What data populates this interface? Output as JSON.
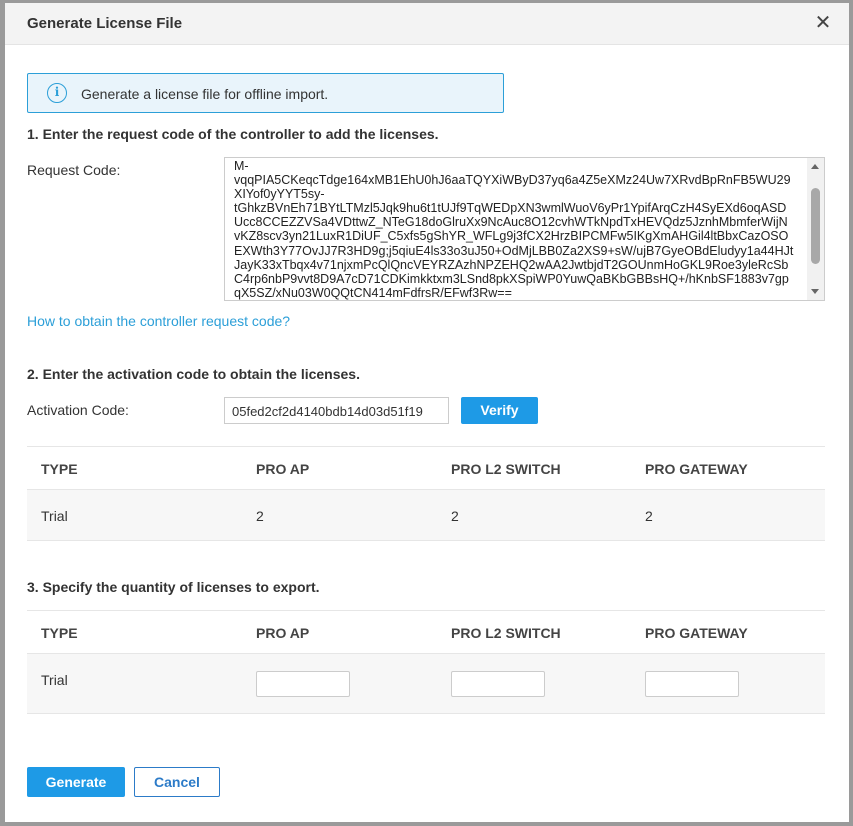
{
  "dialog": {
    "title": "Generate License File",
    "close_icon": "close-icon"
  },
  "info": {
    "icon": "info-icon",
    "icon_glyph": "i",
    "text": "Generate a license file for offline import."
  },
  "step1": {
    "title": "1. Enter the request code of the controller to add the licenses.",
    "request_label": "Request Code:",
    "request_code": "M-\nvqqPIA5CKeqcTdge164xMB1EhU0hJ6aaTQYXiWByD37yq6a4Z5eXMz24Uw7XRvdBpRnFB5WU29\nXIYof0yYYT5sy-\ntGhkzBVnEh71BYtLTMzl5Jqk9hu6t1tUJf9TqWEDpXN3wmlWuoV6yPr1YpifArqCzH4SyEXd6oqASD\nUcc8CCEZZVSa4VDttwZ_NTeG18doGlruXx9NcAuc8O12cvhWTkNpdTxHEVQdz5JznhMbmferWijN\nvKZ8scv3yn21LuxR1DiUF_C5xfs5gShYR_WFLg9j3fCX2HrzBIPCMFw5IKgXmAHGil4ltBbxCazOSO\nEXWth3Y77OvJJ7R3HD9g;j5qiuE4ls33o3uJ50+OdMjLBB0Za2XS9+sW/ujB7GyeOBdEludyy1a44HJt\nJayK33xTbqx4v71njxmPcQlQncVEYRZAzhNPZEHQ2wAA2JwtbjdT2GOUnmHoGKL9Roe3yleRcSb\nC4rp6nbP9vvt8D9A7cD71CDKimkktxm3LSnd8pkXSpiWP0YuwQaBKbGBBsHQ+/hKnbSF1883v7gp\nqX5SZ/xNu03W0QQtCN414mFdfrsR/EFwf3Rw==",
    "help_link": "How to obtain the controller request code?"
  },
  "step2": {
    "title": "2. Enter the activation code to obtain the licenses.",
    "activation_label": "Activation Code:",
    "activation_value": "05fed2cf2d4140bdb14d03d51f19",
    "verify_label": "Verify",
    "table": {
      "headers": [
        "TYPE",
        "PRO AP",
        "PRO L2 SWITCH",
        "PRO GATEWAY"
      ],
      "rows": [
        [
          "Trial",
          "2",
          "2",
          "2"
        ]
      ]
    }
  },
  "step3": {
    "title": "3. Specify the quantity of licenses to export.",
    "table": {
      "headers": [
        "TYPE",
        "PRO AP",
        "PRO L2 SWITCH",
        "PRO GATEWAY"
      ],
      "rows": [
        {
          "type": "Trial",
          "pro_ap": "",
          "pro_l2_switch": "",
          "pro_gateway": ""
        }
      ]
    }
  },
  "footer": {
    "generate_label": "Generate",
    "cancel_label": "Cancel"
  },
  "colors": {
    "accent": "#1e9ae6",
    "link": "#2c9fd8",
    "info_bg": "#e9f4fb"
  }
}
